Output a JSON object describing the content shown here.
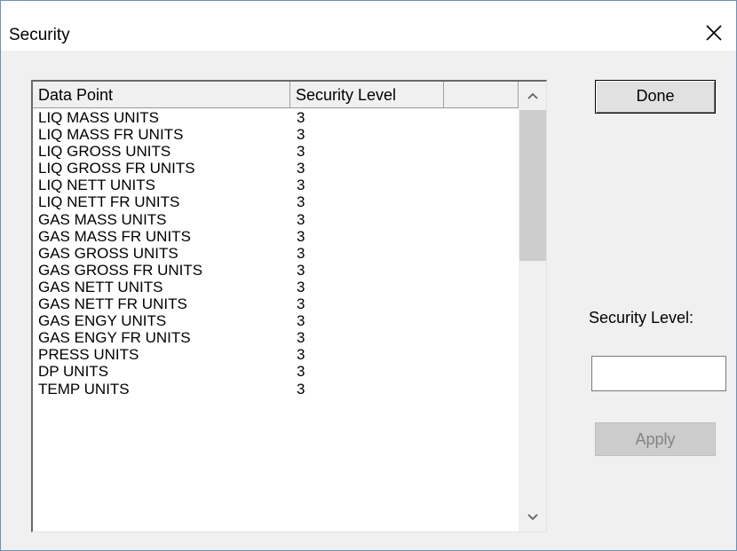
{
  "window": {
    "title": "Security"
  },
  "list": {
    "columns": [
      "Data Point",
      "Security Level",
      ""
    ],
    "rows": [
      {
        "name": "LIQ MASS UNITS",
        "level": "3"
      },
      {
        "name": "LIQ MASS FR UNITS",
        "level": "3"
      },
      {
        "name": "LIQ GROSS UNITS",
        "level": "3"
      },
      {
        "name": "LIQ GROSS FR UNITS",
        "level": "3"
      },
      {
        "name": "LIQ NETT UNITS",
        "level": "3"
      },
      {
        "name": "LIQ NETT FR UNITS",
        "level": "3"
      },
      {
        "name": "GAS MASS UNITS",
        "level": "3"
      },
      {
        "name": "GAS MASS FR UNITS",
        "level": "3"
      },
      {
        "name": "GAS GROSS UNITS",
        "level": "3"
      },
      {
        "name": "GAS GROSS FR UNITS",
        "level": "3"
      },
      {
        "name": "GAS NETT UNITS",
        "level": "3"
      },
      {
        "name": "GAS NETT FR UNITS",
        "level": "3"
      },
      {
        "name": "GAS ENGY UNITS",
        "level": "3"
      },
      {
        "name": "GAS ENGY FR UNITS",
        "level": "3"
      },
      {
        "name": "PRESS UNITS",
        "level": "3"
      },
      {
        "name": "DP UNITS",
        "level": "3"
      },
      {
        "name": "TEMP UNITS",
        "level": "3"
      }
    ]
  },
  "buttons": {
    "done": "Done",
    "apply": "Apply"
  },
  "level_field": {
    "label": "Security Level:",
    "value": ""
  },
  "icons": {
    "close": "close-icon",
    "scroll_up": "chevron-up-icon",
    "scroll_down": "chevron-down-icon"
  }
}
